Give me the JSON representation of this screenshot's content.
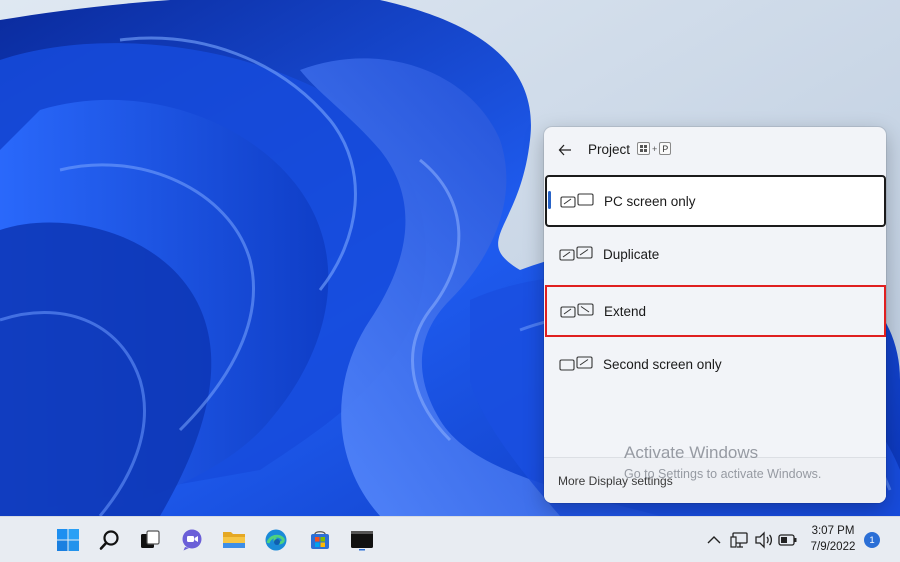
{
  "flyout": {
    "title": "Project",
    "shortcut_plus": "+",
    "shortcut_key": "P",
    "options": [
      {
        "label": "PC screen only",
        "selected": true
      },
      {
        "label": "Duplicate",
        "selected": false
      },
      {
        "label": "Extend",
        "selected": false,
        "highlighted": true
      },
      {
        "label": "Second screen only",
        "selected": false
      }
    ],
    "footer_link": "More Display settings"
  },
  "watermark": {
    "title": "Activate Windows",
    "subtitle": "Go to Settings to activate Windows."
  },
  "taskbar": {
    "apps": [
      "start-icon",
      "search-icon",
      "task-view-icon",
      "teams-chat-icon",
      "file-explorer-icon",
      "edge-icon",
      "microsoft-store-icon",
      "terminal-icon"
    ],
    "clock_time": "3:07 PM",
    "clock_date": "7/9/2022",
    "notification_count": "1"
  },
  "colors": {
    "accent": "#2863c7",
    "highlight_border": "#e02020",
    "wallpaper_blue": "#1f56e0"
  }
}
